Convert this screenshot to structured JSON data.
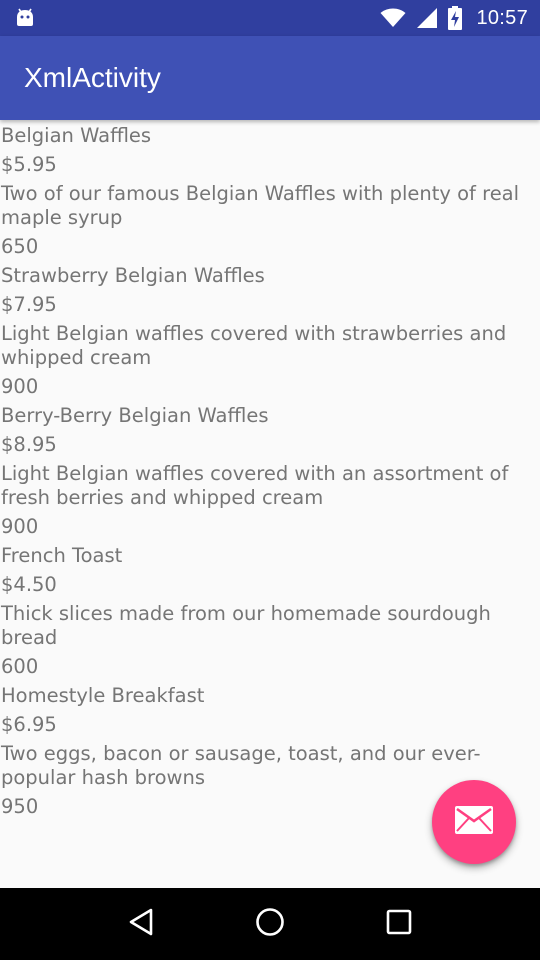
{
  "status_bar": {
    "time": "10:57",
    "icons": [
      "android-icon",
      "wifi-icon",
      "signal-icon",
      "battery-charging-icon"
    ]
  },
  "app_bar": {
    "title": "XmlActivity",
    "color": "#3f51b5"
  },
  "menu": {
    "items": [
      {
        "name": "Belgian Waffles",
        "price": "$5.95",
        "description": "Two of our famous Belgian Waffles with plenty of real maple syrup",
        "calories": "650"
      },
      {
        "name": "Strawberry Belgian Waffles",
        "price": "$7.95",
        "description": "Light Belgian waffles covered with strawberries and whipped cream",
        "calories": "900"
      },
      {
        "name": "Berry-Berry Belgian Waffles",
        "price": "$8.95",
        "description": "Light Belgian waffles covered with an assortment of fresh berries and whipped cream",
        "calories": "900"
      },
      {
        "name": "French Toast",
        "price": "$4.50",
        "description": "Thick slices made from our homemade sourdough bread",
        "calories": "600"
      },
      {
        "name": "Homestyle Breakfast",
        "price": "$6.95",
        "description": "Two eggs, bacon or sausage, toast, and our ever-popular hash browns",
        "calories": "950"
      }
    ]
  },
  "fab": {
    "icon": "email-icon",
    "color": "#ff4081"
  },
  "nav_bar": {
    "icons": [
      "back-icon",
      "home-icon",
      "recents-icon"
    ]
  }
}
